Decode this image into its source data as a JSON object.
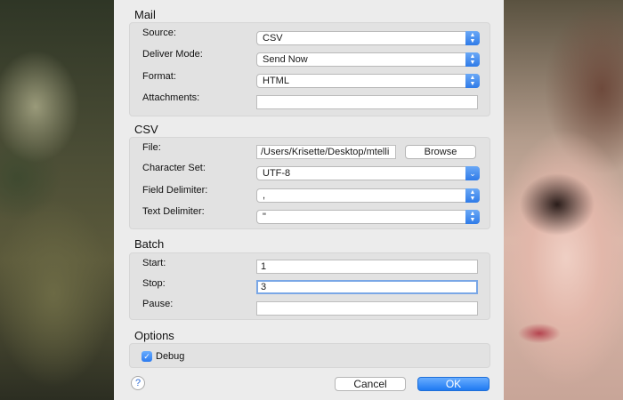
{
  "mail": {
    "title": "Mail",
    "source_label": "Source:",
    "source_value": "CSV",
    "deliver_label": "Deliver Mode:",
    "deliver_value": "Send Now",
    "format_label": "Format:",
    "format_value": "HTML",
    "attachments_label": "Attachments:",
    "attachments_value": ""
  },
  "csv": {
    "title": "CSV",
    "file_label": "File:",
    "file_value": "/Users/Krisette/Desktop/mtelli",
    "browse_label": "Browse",
    "charset_label": "Character Set:",
    "charset_value": "UTF-8",
    "field_delim_label": "Field Delimiter:",
    "field_delim_value": ",",
    "text_delim_label": "Text Delimiter:",
    "text_delim_value": "\""
  },
  "batch": {
    "title": "Batch",
    "start_label": "Start:",
    "start_value": "1",
    "stop_label": "Stop:",
    "stop_value": "3",
    "pause_label": "Pause:",
    "pause_value": ""
  },
  "options": {
    "title": "Options",
    "debug_label": "Debug",
    "debug_checked": true
  },
  "footer": {
    "help_label": "?",
    "cancel_label": "Cancel",
    "ok_label": "OK"
  },
  "colors": {
    "accent": "#2f7be8",
    "dialog_bg": "#ececec",
    "group_bg": "#e2e2e2"
  }
}
